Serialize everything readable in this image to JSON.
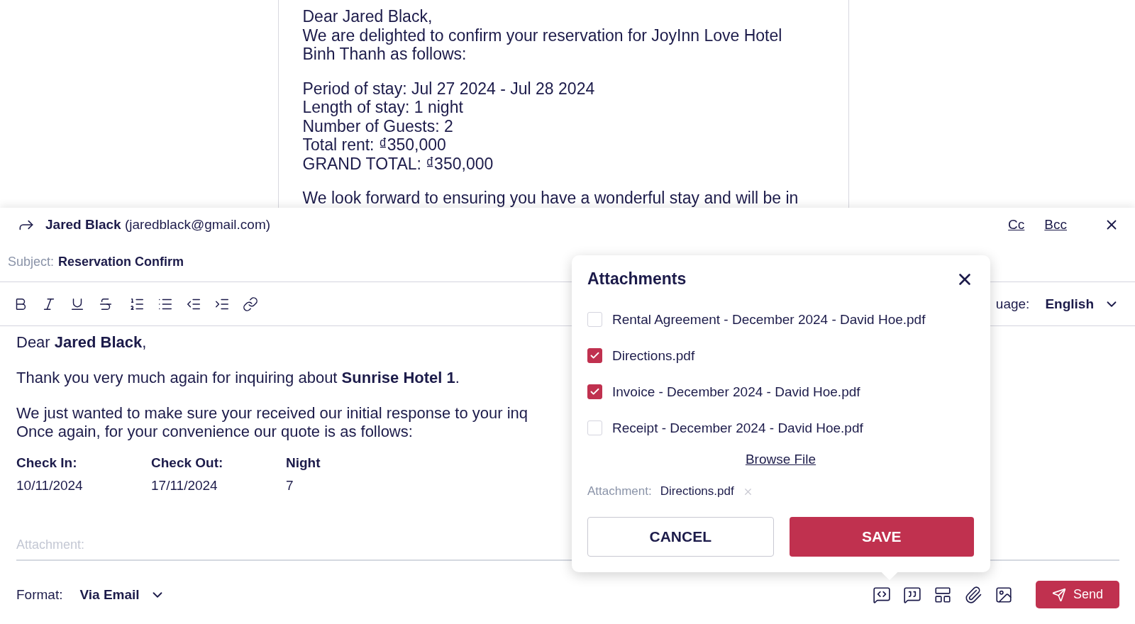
{
  "preview": {
    "paragraphs": [
      [
        "Dear Jared Black,",
        "We are delighted to confirm your reservation for JoyInn Love Hotel",
        "Binh Thanh as follows:"
      ],
      [
        "Period of stay: Jul 27 2024 - Jul 28 2024",
        "Length of stay: 1 night",
        "Number of Guests: 2",
        "Total rent: ₫350,000",
        "GRAND TOTAL: ₫350,000"
      ],
      [
        "We look forward to ensuring you have a wonderful stay and will be in"
      ]
    ]
  },
  "compose": {
    "recipient_name": "Jared Black",
    "recipient_email": "(jaredblack@gmail.com)",
    "cc": "Cc",
    "bcc": "Bcc",
    "subject_label": "Subject:",
    "subject": "Reservation Confirm",
    "language_label": "uage:",
    "language": "English",
    "body": [
      [
        "Dear **Jared Black**,"
      ],
      [
        "Thank you very much again for inquiring about **Sunrise Hotel 1**."
      ],
      [
        "We just wanted to make sure your received our initial response to your inq",
        "Once again, for your convenience our quote is as follows:"
      ]
    ],
    "table": {
      "columns": [
        "Check In:",
        "Check Out:",
        "Night"
      ],
      "rows": [
        [
          "10/11/2024",
          "17/11/2024",
          "7"
        ]
      ]
    },
    "attachment_placeholder": "Attachment:",
    "format_label": "Format:",
    "format": "Via Email",
    "send": "Send"
  },
  "attachments_popup": {
    "title": "Attachments",
    "files": [
      {
        "name": "Rental Agreement - December 2024 - David Hoe.pdf",
        "checked": false
      },
      {
        "name": "Directions.pdf",
        "checked": true
      },
      {
        "name": "Invoice - December 2024 - David Hoe.pdf",
        "checked": true
      },
      {
        "name": "Receipt - December 2024 - David Hoe.pdf",
        "checked": false
      }
    ],
    "browse": "Browse File",
    "attachment_label": "Attachment:",
    "attachment_value": "Directions.pdf",
    "cancel": "CANCEL",
    "save": "SAVE"
  }
}
